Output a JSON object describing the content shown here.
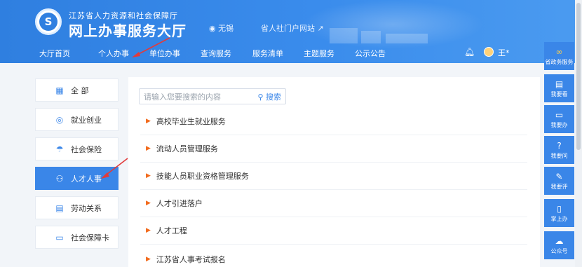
{
  "header": {
    "org_name": "江苏省人力资源和社会保障厅",
    "site_name": "网上办事服务大厅",
    "location": "无锡",
    "portal_link": "省人社门户网站",
    "user_name": "王*"
  },
  "nav": {
    "items": [
      "大厅首页",
      "个人办事",
      "单位办事",
      "查询服务",
      "服务清单",
      "主题服务",
      "公示公告"
    ],
    "active_index": 1
  },
  "sidebar": {
    "items": [
      {
        "label": "全 部",
        "icon": "grid-icon"
      },
      {
        "label": "就业创业",
        "icon": "compass-icon"
      },
      {
        "label": "社会保险",
        "icon": "umbrella-icon"
      },
      {
        "label": "人才人事",
        "icon": "people-icon"
      },
      {
        "label": "劳动关系",
        "icon": "document-icon"
      },
      {
        "label": "社会保障卡",
        "icon": "card-icon"
      }
    ],
    "active_index": 3
  },
  "search": {
    "placeholder": "请输入您要搜索的内容",
    "button_label": "搜索"
  },
  "services": [
    "高校毕业生就业服务",
    "流动人员管理服务",
    "技能人员职业资格管理服务",
    "人才引进落户",
    "人才工程",
    "江苏省人事考试报名"
  ],
  "right_bar": {
    "items": [
      "省政务服务",
      "我要看",
      "我要办",
      "我要问",
      "我要评",
      "掌上办",
      "公众号"
    ]
  },
  "colors": {
    "header_blue": "#3a86e8",
    "accent_blue": "#3a86e8",
    "bullet_orange": "#f26b1d",
    "arrow_red": "#e23b3b"
  }
}
